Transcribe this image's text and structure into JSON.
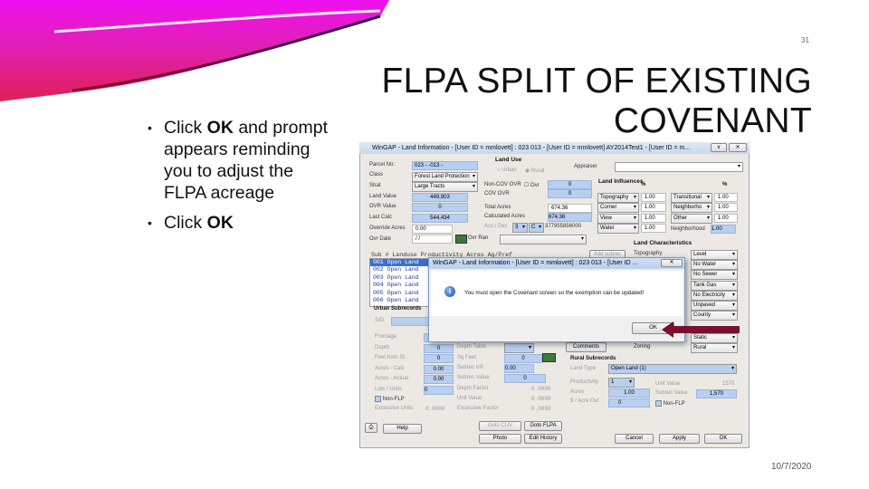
{
  "slide": {
    "page_number": "31",
    "title_line1": "FLPA SPLIT OF EXISTING",
    "title_line2": "COVENANT",
    "date": "10/7/2020",
    "bullets": [
      {
        "pre": "Click ",
        "bold": "OK",
        "post": " and prompt appears reminding you to adjust the FLPA acreage"
      },
      {
        "pre": "Click ",
        "bold": "OK",
        "post": ""
      }
    ]
  },
  "window": {
    "title": "WinGAP - Land Information - [User ID = mmlovett] : 023    013            - [User ID = mmlovett] AY2014Test1 - [User ID = m...",
    "parcel_no_label": "Parcel No:",
    "parcel_no": "023 -  -013 -",
    "class_label": "Class",
    "class_value": "Forest Land Protection",
    "strat_label": "Strat",
    "strat_value": "Large Tracts",
    "land_value_label": "Land Value",
    "land_value": "449,903",
    "ovr_value_label": "OVR Value",
    "ovr_value": "0",
    "last_calc_label": "Last Calc",
    "last_calc": "544,434",
    "override_acres_label": "Override Acres",
    "override_acres": "0.00",
    "ovr_date_label": "Ovr Date",
    "ovr_date": "/ /",
    "ovr_ran_label": "Ovr Ran",
    "land_use_label": "Land Use",
    "urban_label": "Urban",
    "rural_label": "Rural",
    "appraiser_label": "Appraiser",
    "non_cov_ovr_label": "Non-COV OVR",
    "ovr_checkbox_label": "Ovr",
    "non_cov_ovr": "0",
    "cov_ovr_label": "COV OVR",
    "cov_ovr": "0",
    "total_acres_label": "Total Acres",
    "total_acres": "674.36",
    "calc_acres_label": "Calculated Acres",
    "calc_acres": "674.36",
    "acc_dec_label": "Acc / Dec",
    "acc": "3",
    "dec": "C",
    "acc_number": "377955856000",
    "land_influences_label": "Land Influences",
    "percent": "%",
    "influences_left": [
      {
        "name": "Topography",
        "value": "1.00"
      },
      {
        "name": "Corner",
        "value": "1.00"
      },
      {
        "name": "View",
        "value": "1.00"
      },
      {
        "name": "Water",
        "value": "1.00"
      }
    ],
    "influences_right": [
      {
        "name": "Transitional",
        "value": "1.00"
      },
      {
        "name": "Neighborho",
        "value": "1.00"
      },
      {
        "name": "Other",
        "value": "1.00"
      }
    ],
    "neighborhood_label": "Neighborhood",
    "neighborhood": "1.00",
    "land_char_label": "Land Characteristics",
    "topography_label": "Topography",
    "characteristics": [
      "Level",
      "No Water",
      "No Sewer",
      "Tank Gas",
      "No Electricity",
      "Unpaved",
      "County"
    ],
    "characteristics2": [
      "Static",
      "Rural"
    ],
    "zoning_label": "Zoning",
    "comments_button": "Comments",
    "add_subrec_button": "Add subrec",
    "list_header": "Sub #  Landuse   Productivity  Acres   Ag/Pref",
    "list_rows": [
      "001   Open Land",
      "002   Open Land",
      "003   Open Land",
      "004   Open Land",
      "005   Open Land",
      "006   Open Land"
    ],
    "urban_sub_label": "Urban Subrecords",
    "sd_label": "S/D",
    "urban_fields": [
      {
        "label": "Frontage",
        "value": ""
      },
      {
        "label": "Depth",
        "value": "0"
      },
      {
        "label": "Feet from St",
        "value": "0"
      },
      {
        "label": "Acres - Calc",
        "value": "0.00"
      },
      {
        "label": "Acres - Actual",
        "value": "0.00"
      },
      {
        "label": "Lots / Units",
        "value": "0"
      }
    ],
    "depth_table_label": "Depth Table",
    "sq_feet_label": "Sq Feet",
    "sq_feet": "0",
    "subrec_infl_label": "Subrec Infl",
    "subrec_infl": "0.00",
    "subrec_value_label": "Subrec Value",
    "subrec_value": "0",
    "depth_factor_label": "Depth Factor",
    "depth_factor": "0.0000",
    "unit_value_label": "Unit Value",
    "unit_value": "0.0000",
    "excessive_factor_label": "Excessive Factor",
    "excessive_factor": "0.0000",
    "non_flp_label": "Non-FLP",
    "excessive_units_label": "Excessive Units",
    "excessive_units": "0.0000",
    "rural_sub_label": "Rural Subrecords",
    "land_type_label": "Land Type",
    "land_type": "Open Land      (1)",
    "productivity_label": "Productivity",
    "productivity": "1",
    "r_unit_value_label": "Unit Value",
    "r_unit_value": "1570",
    "r_acres_label": "Acres",
    "r_acres": "1.00",
    "r_subrec_value_label": "Subrec Value",
    "r_subrec_value": "1,570",
    "acre_ovr_label": "$ / Acre Ovr",
    "acre_ovr": "0",
    "r_non_flp_label": "Non-FLP",
    "buttons": {
      "help": "Help",
      "goto_cuv": "Goto CUV",
      "goto_flpa": "Goto FLPA",
      "photo": "Photo",
      "edit_history": "Edit History",
      "cancel": "Cancel",
      "apply": "Apply",
      "ok": "OK"
    }
  },
  "dialog": {
    "title": "WinGAP - Land Information - [User ID = mmlovett] : 023    013            - [User ID ...",
    "message": "You must open the Covenant screen so the exemption can be updated!",
    "ok": "OK"
  },
  "colors": {
    "arrow": "#7a1030",
    "field_blue": "#b8cff0",
    "swoosh_magenta": "#e010e0",
    "swoosh_red": "#e0204a"
  }
}
